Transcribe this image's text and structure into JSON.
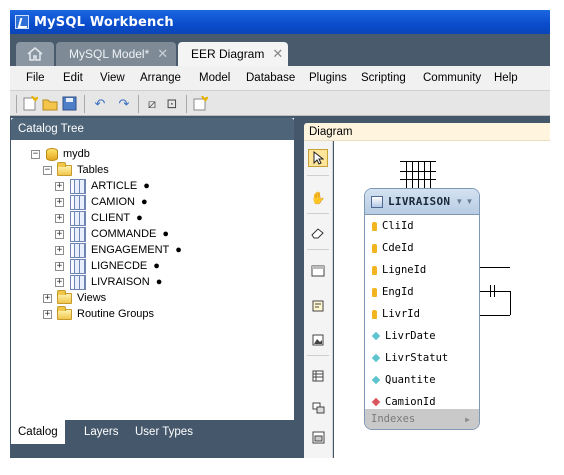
{
  "window": {
    "title": "MySQL Workbench"
  },
  "tabs": [
    {
      "label": "MySQL Model*",
      "close": "✕"
    },
    {
      "label": "EER Diagram",
      "close": "✕"
    }
  ],
  "menu": [
    "File",
    "Edit",
    "View",
    "Arrange",
    "Model",
    "Database",
    "Plugins",
    "Scripting",
    "Community",
    "Help"
  ],
  "catalog": {
    "title": "Catalog Tree",
    "schema": "mydb",
    "tables_label": "Tables",
    "tables": [
      "ARTICLE",
      "CAMION",
      "CLIENT",
      "COMMANDE",
      "ENGAGEMENT",
      "LIGNECDE",
      "LIVRAISON"
    ],
    "marker": "●",
    "views_label": "Views",
    "routines_label": "Routine Groups",
    "expand_minus": "−",
    "expand_plus": "+"
  },
  "bottom_tabs": [
    "Catalog",
    "Layers",
    "User Types"
  ],
  "diagram": {
    "title": "Diagram",
    "entity": {
      "name": "LIVRAISON",
      "columns": [
        {
          "name": "CliId",
          "kind": "key"
        },
        {
          "name": "CdeId",
          "kind": "key"
        },
        {
          "name": "LigneId",
          "kind": "key"
        },
        {
          "name": "EngId",
          "kind": "key"
        },
        {
          "name": "LivrId",
          "kind": "key"
        },
        {
          "name": "LivrDate",
          "kind": "column"
        },
        {
          "name": "LivrStatut",
          "kind": "column"
        },
        {
          "name": "Quantite",
          "kind": "column"
        },
        {
          "name": "CamionId",
          "kind": "foreign-key"
        }
      ],
      "footer": "Indexes"
    }
  },
  "colors": {
    "key": "#f2b520",
    "column": "#5fc3cf",
    "foreign_key": "#d9565f"
  }
}
